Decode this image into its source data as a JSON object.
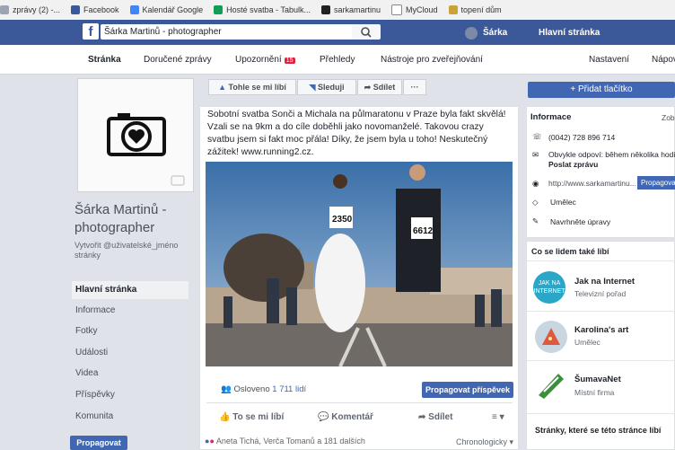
{
  "bookmarks": [
    {
      "label": "zprávy (2) -...",
      "color": "#9aa4b2"
    },
    {
      "label": "Facebook",
      "color": "#3b5998"
    },
    {
      "label": "Kalendář Google",
      "color": "#4285f4"
    },
    {
      "label": "Hosté svatba - Tabulk...",
      "color": "#0f9d58"
    },
    {
      "label": "sarkamartinu",
      "color": "#222222"
    },
    {
      "label": "MyCloud",
      "color": "#888888"
    },
    {
      "label": "topení dům",
      "color": "#c9a23a"
    }
  ],
  "header": {
    "search_value": "Šárka Martinů - photographer",
    "user_name": "Šárka",
    "home_link": "Hlavní stránka"
  },
  "page_tabs": {
    "page": "Stránka",
    "inbox": "Doručené zprávy",
    "notifications": "Upozornění",
    "notifications_count": "15",
    "insights": "Přehledy",
    "publishing_tools": "Nástroje pro zveřejňování",
    "settings": "Nastavení",
    "help": "Nápověda"
  },
  "left": {
    "page_name": "Šárka Martinů - photographer",
    "create_username": "Vytvořit @uživatelské_jméno stránky",
    "nav": [
      "Hlavní stránka",
      "Informace",
      "Fotky",
      "Události",
      "Videa",
      "Příspěvky",
      "Komunita"
    ],
    "promote_label": "Propagovat"
  },
  "actions": {
    "like": "Tohle se mi líbí",
    "follow": "Sleduji",
    "share": "Sdílet",
    "more": "···"
  },
  "post": {
    "text": "Sobotní svatba Sonči a Michala na půlmaratonu v Praze byla fakt skvělá! Vzali se na 9km a do cíle doběhli jako novomanželé. Takovou crazy svatbu jsem si fakt moc přála! Díky, že jsem byla u toho! Neskutečný zážitek! www.running2.cz.",
    "bib_bride": "2350",
    "bib_groom": "6612",
    "reached_label": "Osloveno",
    "reached_count": "1 711 lidí",
    "boost_label": "Propagovat příspěvek",
    "like_label": "To se mi líbí",
    "comment_label": "Komentář",
    "share_label": "Sdílet",
    "reactions_text": "Aneta Tichá, Verča Tomanů a 181 dalších",
    "sort_label": "Chronologicky"
  },
  "right": {
    "add_button": "+ Přidat tlačítko",
    "info_title": "Informace",
    "info_link": "Zobrazit vše",
    "phone": "(0042) 728 896 714",
    "response": "Obvykle odpoví: během několika hodin",
    "send_message": "Poslat zprávu",
    "website": "http://www.sarkamartinu...",
    "promote": "Propagovat",
    "category": "Umělec",
    "suggest_edits": "Navrhněte úpravy",
    "likes_title": "Co se lidem také líbí",
    "liked_pages": [
      {
        "name": "Jak na Internet",
        "sub": "Televizní pořad",
        "color": "#2aa6c9"
      },
      {
        "name": "Karolina's art",
        "sub": "Umělec",
        "color": "#c7d6e0"
      },
      {
        "name": "ŠumavaNet",
        "sub": "Místní firma",
        "color": "#3a8f3a"
      }
    ],
    "liked_by_title": "Stránky, které se této stránce líbí"
  }
}
